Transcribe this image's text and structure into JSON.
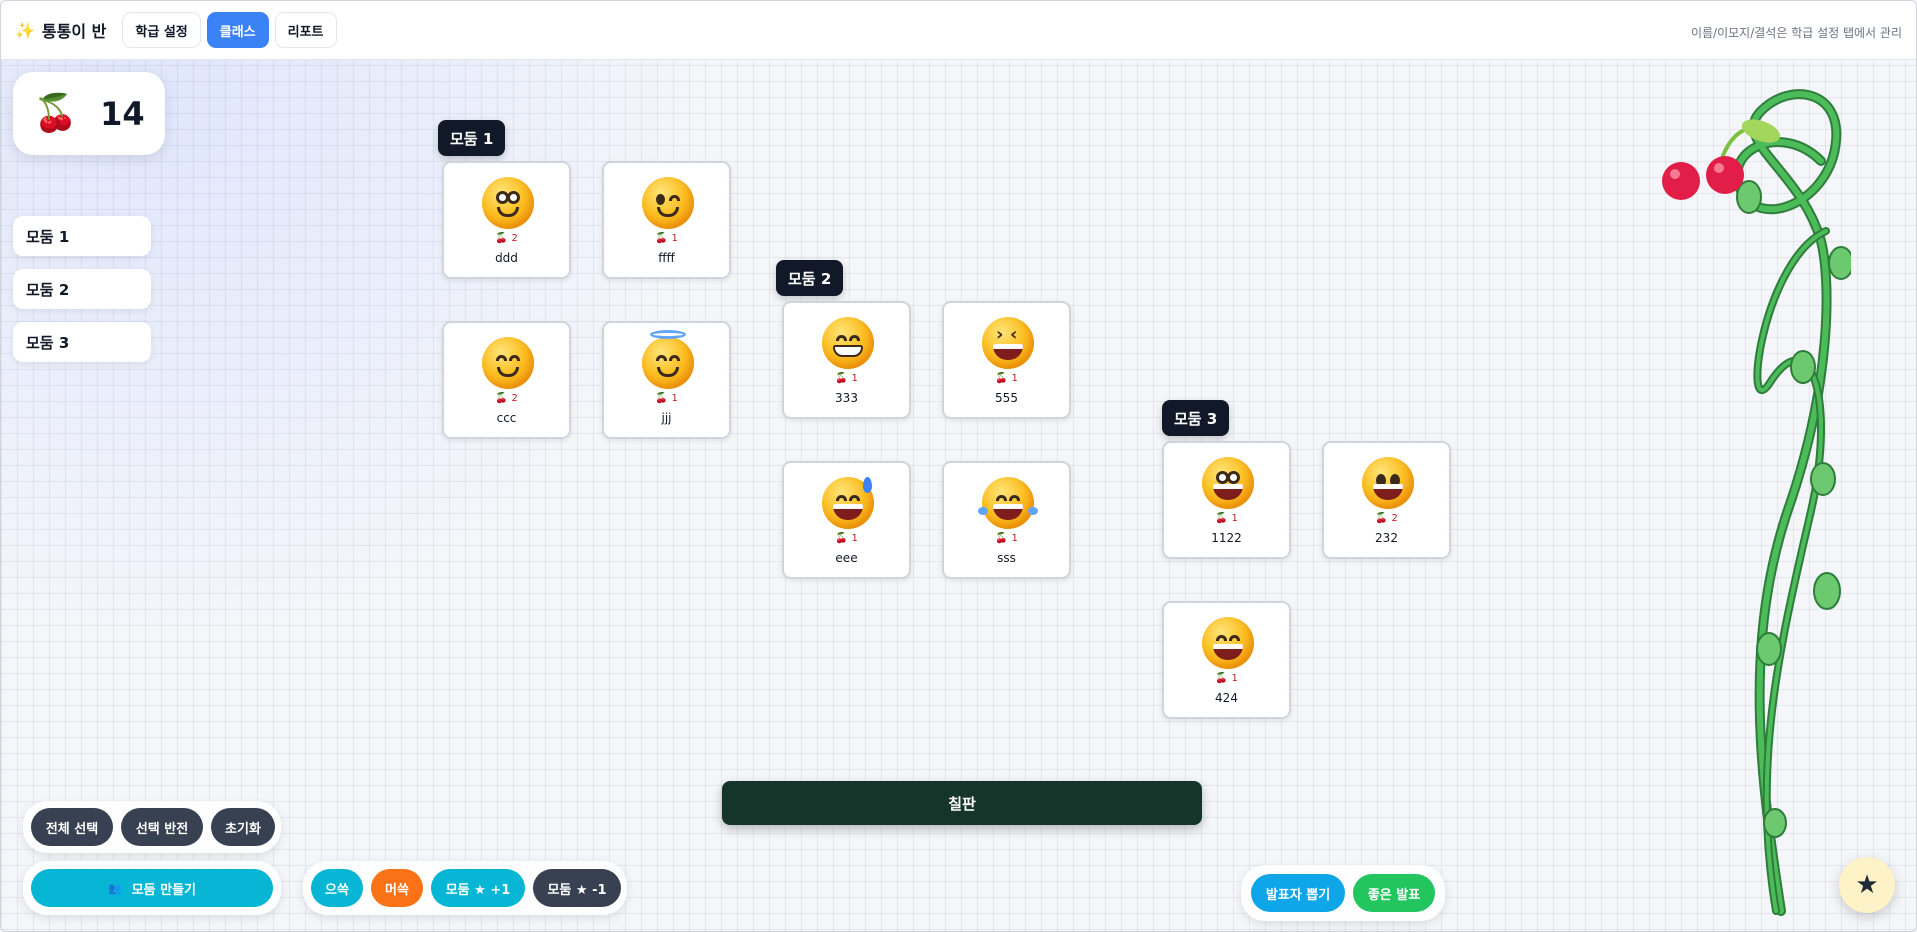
{
  "header": {
    "brand_icon": "sparkles-icon",
    "brand_title": "통통이 반",
    "tabs": [
      {
        "label": "학급 설정",
        "active": false
      },
      {
        "label": "클래스",
        "active": true
      },
      {
        "label": "리포트",
        "active": false
      }
    ],
    "hint": "이름/이모지/결석은 학급 설정 탭에서 관리"
  },
  "counter": {
    "icon": "cherry-icon",
    "value": "14"
  },
  "sidebar": {
    "groups": [
      "모둠 1",
      "모둠 2",
      "모둠 3"
    ]
  },
  "groups": [
    {
      "label": "모둠 1",
      "students": [
        {
          "name": "ddd",
          "points": "2",
          "emoji": "smiling-face-icon"
        },
        {
          "name": "ffff",
          "points": "1",
          "emoji": "winking-face-icon"
        },
        {
          "name": "ccc",
          "points": "2",
          "emoji": "smiling-eyes-face-icon"
        },
        {
          "name": "jjj",
          "points": "1",
          "emoji": "halo-face-icon"
        }
      ]
    },
    {
      "label": "모둠 2",
      "students": [
        {
          "name": "333",
          "points": "1",
          "emoji": "beaming-face-icon"
        },
        {
          "name": "555",
          "points": "1",
          "emoji": "squinting-laugh-face-icon"
        },
        {
          "name": "eee",
          "points": "1",
          "emoji": "sweat-smile-face-icon"
        },
        {
          "name": "sss",
          "points": "1",
          "emoji": "tears-of-joy-face-icon"
        }
      ]
    },
    {
      "label": "모둠 3",
      "students": [
        {
          "name": "1122",
          "points": "1",
          "emoji": "grinning-big-eyes-face-icon"
        },
        {
          "name": "232",
          "points": "2",
          "emoji": "grinning-big-eyes-face-icon"
        },
        {
          "name": "424",
          "points": "1",
          "emoji": "grinning-smiling-eyes-face-icon"
        }
      ]
    }
  ],
  "blackboard": {
    "label": "칠판"
  },
  "controls": {
    "select_all": "전체 선택",
    "invert": "선택 반전",
    "reset": "초기화",
    "make_groups_icon": "people-icon",
    "make_groups": "모둠 만들기",
    "good": "으쓱",
    "shy": "머쓱",
    "group_plus": "모둠 ★ +1",
    "group_minus": "모둠 ★ -1",
    "pick_presenter": "발표자 뽑기",
    "good_presentation": "좋은 발표",
    "fab_icon": "star-icon",
    "fab_glyph": "★"
  },
  "colors": {
    "accent": "#3b82f6",
    "cherry": "#e11d48",
    "blackboard": "#16352a",
    "vine": "#3da64a"
  }
}
